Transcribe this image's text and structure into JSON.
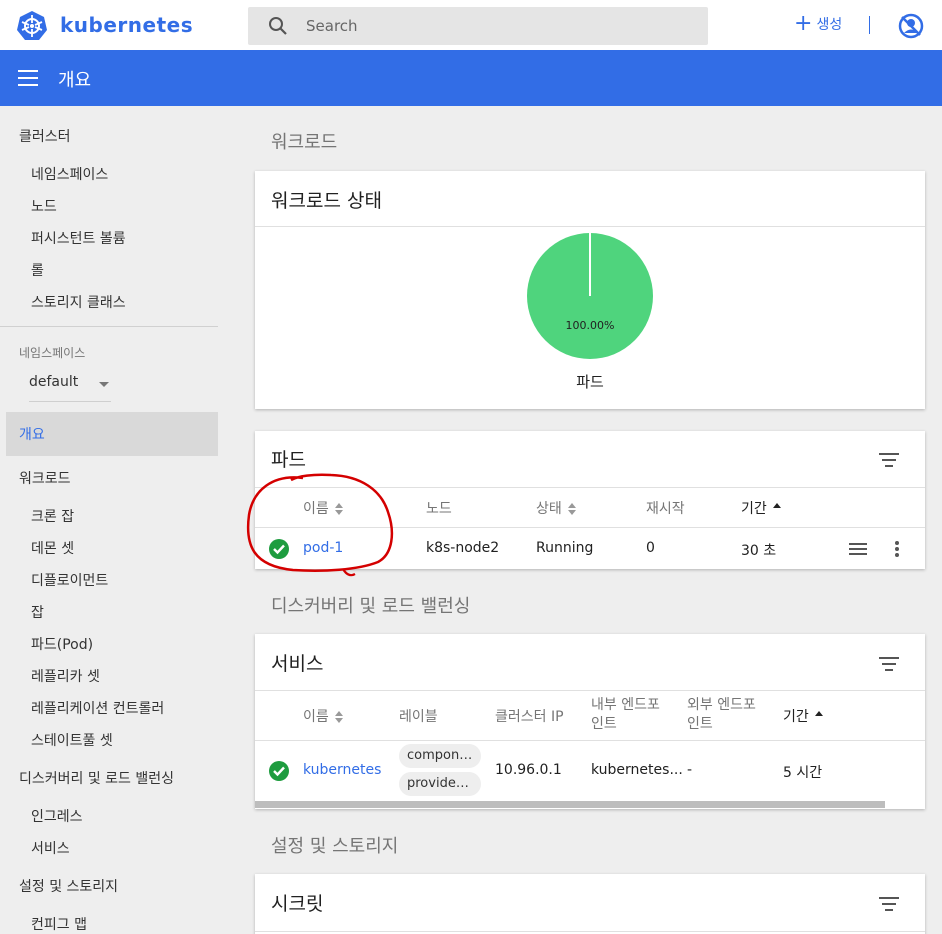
{
  "topbar": {
    "brand": "kubernetes",
    "search_placeholder": "Search",
    "create_label": "생성",
    "create_plus": "+"
  },
  "titlebar": {
    "title": "개요"
  },
  "sidebar": {
    "cluster": "클러스터",
    "cluster_items": [
      "네임스페이스",
      "노드",
      "퍼시스턴트 볼륨",
      "롤",
      "스토리지 클래스"
    ],
    "namespace_label": "네임스페이스",
    "namespace_value": "default",
    "overview": "개요",
    "workloads": "워크로드",
    "workload_items": [
      "크론 잡",
      "데몬 셋",
      "디플로이먼트",
      "잡",
      "파드(Pod)",
      "레플리카 셋",
      "레플리케이션 컨트롤러",
      "스테이트풀 셋"
    ],
    "discovery": "디스커버리 및 로드 밸런싱",
    "discovery_items": [
      "인그레스",
      "서비스"
    ],
    "config": "설정 및 스토리지",
    "config_items": [
      "컨피그 맵"
    ]
  },
  "main": {
    "workloads_section": "워크로드",
    "workload_status_title": "워크로드 상태",
    "pie": {
      "percent_label": "100.00%",
      "caption": "파드",
      "color": "#4fd47d"
    },
    "pods_title": "파드",
    "pods_headers": {
      "name": "이름",
      "node": "노드",
      "status": "상태",
      "restarts": "재시작",
      "age": "기간"
    },
    "pods_rows": [
      {
        "name": "pod-1",
        "node": "k8s-node2",
        "status": "Running",
        "restarts": "0",
        "age": "30 초"
      }
    ],
    "discovery_section": "디스커버리 및 로드 밸런싱",
    "services_title": "서비스",
    "services_headers": {
      "name": "이름",
      "labels": "레이블",
      "cluster_ip": "클러스터 IP",
      "internal_1": "내부 엔드포",
      "internal_2": "인트",
      "external_1": "외부 엔드포",
      "external_2": "인트",
      "age": "기간"
    },
    "services_rows": [
      {
        "name": "kubernetes",
        "label_1": "componen...",
        "label_2": "provider: k...",
        "cluster_ip": "10.96.0.1",
        "internal": "kubernetes...",
        "external": "-",
        "age": "5 시간"
      }
    ],
    "config_section": "설정 및 스토리지",
    "secrets_title": "시크릿"
  },
  "colors": {
    "accent": "#326de6",
    "ok": "#1e9c3f",
    "annotation": "#d40000"
  }
}
